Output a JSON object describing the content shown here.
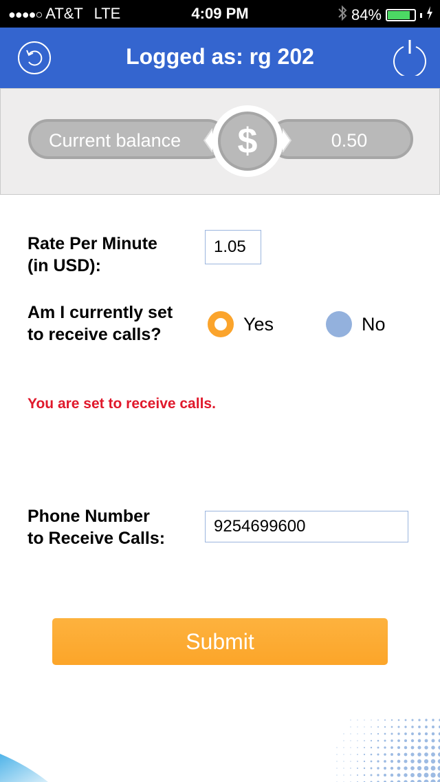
{
  "status_bar": {
    "signal": "●●●●○",
    "carrier": "AT&T",
    "network": "LTE",
    "time": "4:09 PM",
    "battery_percent_label": "84%",
    "battery_level": 0.84,
    "battery_color": "#4cd964"
  },
  "header": {
    "title": "Logged as: rg 202",
    "left_icon": "refresh-icon",
    "right_icon": "power-icon",
    "background": "#3465cf"
  },
  "balance": {
    "label": "Current balance",
    "currency_symbol": "$",
    "value": "0.50"
  },
  "form": {
    "rate_label_line1": "Rate Per Minute",
    "rate_label_line2": "(in USD):",
    "rate_value": "1.05",
    "receive_label_line1": "Am I currently set",
    "receive_label_line2": "to receive calls?",
    "options": [
      {
        "label": "Yes",
        "selected": true,
        "color": "#fba42c"
      },
      {
        "label": "No",
        "selected": false,
        "color": "#93b1dd"
      }
    ],
    "status_message": "You are set to receive calls.",
    "status_color": "#e0182b",
    "phone_label_line1": "Phone Number",
    "phone_label_line2": "to Receive Calls:",
    "phone_value": "9254699600"
  },
  "submit_label": "Submit",
  "accent_color": "#fca529"
}
